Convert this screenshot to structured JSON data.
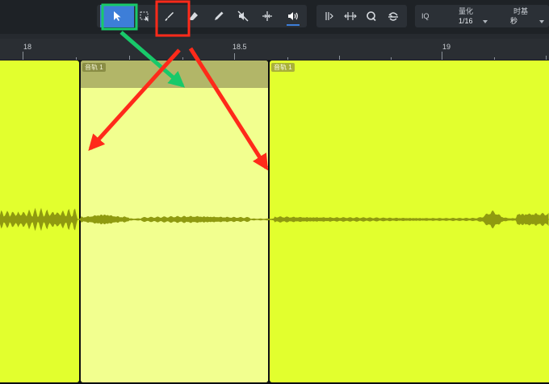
{
  "toolbar": {
    "quantize": {
      "label": "量化",
      "value": "1/16"
    },
    "timebase": {
      "label": "时基",
      "value": "秒"
    },
    "iq_label": "IQ"
  },
  "ruler": {
    "marks": [
      "18",
      "18.5",
      "19"
    ]
  },
  "clips": [
    {
      "name": "音轨 1",
      "selected": true
    },
    {
      "name": "音轨 1",
      "selected": false
    }
  ],
  "colors": {
    "clip": "#e2ff2e",
    "clip_selected": "#f2ff8f",
    "waveform": "#8f9a10",
    "tool_active": "#3d7ed8",
    "highlight_green": "#18c96a",
    "highlight_red": "#ff2a1a"
  },
  "icons": [
    "arrow-cursor-icon",
    "range-select-icon",
    "knife-icon",
    "eraser-icon",
    "pencil-icon",
    "mute-icon",
    "split-icon",
    "speaker-icon",
    "bend-marker-icon",
    "stretch-icon",
    "quantize-q-icon",
    "listen-icon"
  ]
}
